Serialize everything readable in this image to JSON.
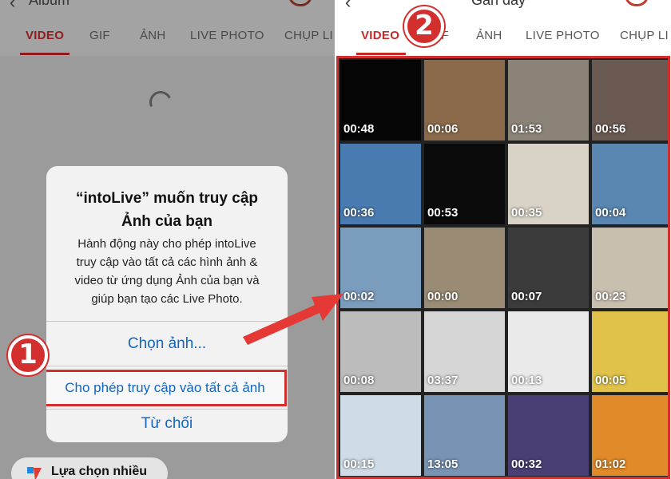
{
  "left": {
    "back_label": "Album",
    "tabs": [
      "VIDEO",
      "GIF",
      "ẢNH",
      "LIVE PHOTO",
      "CHỤP LI"
    ],
    "active_tab": "VIDEO",
    "dialog": {
      "title_line1": "“intoLive” muốn truy cập",
      "title_line2": "Ảnh của bạn",
      "message_line1": "Hành động này cho phép intoLive",
      "message_line2": "truy cập vào tất cả các hình ảnh &",
      "message_line3": "video từ ứng dụng Ảnh của bạn và",
      "message_line4": "giúp bạn tạo các Live Photo.",
      "btn_select": "Chọn ảnh...",
      "btn_allow_all": "Cho phép truy cập vào tất cả ảnh",
      "btn_deny": "Từ chối"
    },
    "pill_label": "Lựa chọn nhiều",
    "step_badge": "1"
  },
  "right": {
    "back_label": "Gần đây",
    "tabs": [
      "VIDEO",
      "GIF",
      "ẢNH",
      "LIVE PHOTO",
      "CHỤP LI"
    ],
    "active_tab": "VIDEO",
    "step_badge": "2",
    "videos": [
      {
        "duration": "00:48",
        "bg": "#050505"
      },
      {
        "duration": "00:06",
        "bg": "#8a6a4a"
      },
      {
        "duration": "01:53",
        "bg": "#8c8378"
      },
      {
        "duration": "00:56",
        "bg": "#6b5a52"
      },
      {
        "duration": "00:36",
        "bg": "#4a7bb0"
      },
      {
        "duration": "00:53",
        "bg": "#0a0a0a"
      },
      {
        "duration": "00:35",
        "bg": "#d9d2c6"
      },
      {
        "duration": "00:04",
        "bg": "#5a86b2"
      },
      {
        "duration": "00:02",
        "bg": "#7a9cbd"
      },
      {
        "duration": "00:00",
        "bg": "#9a8c74"
      },
      {
        "duration": "00:07",
        "bg": "#3b3b3b"
      },
      {
        "duration": "00:23",
        "bg": "#c9bfae"
      },
      {
        "duration": "00:08",
        "bg": "#bcbcbc"
      },
      {
        "duration": "03:37",
        "bg": "#d6d6d6"
      },
      {
        "duration": "00:13",
        "bg": "#eaeaea"
      },
      {
        "duration": "00:05",
        "bg": "#e0c24a"
      },
      {
        "duration": "00:15",
        "bg": "#cfdbe6"
      },
      {
        "duration": "13:05",
        "bg": "#7894b4"
      },
      {
        "duration": "00:32",
        "bg": "#4a3f74"
      },
      {
        "duration": "01:02",
        "bg": "#e08a2a"
      }
    ]
  },
  "colors": {
    "accent": "#d32f2f",
    "link_blue": "#1565c0",
    "dim_overlay": "#9b9b9b"
  }
}
